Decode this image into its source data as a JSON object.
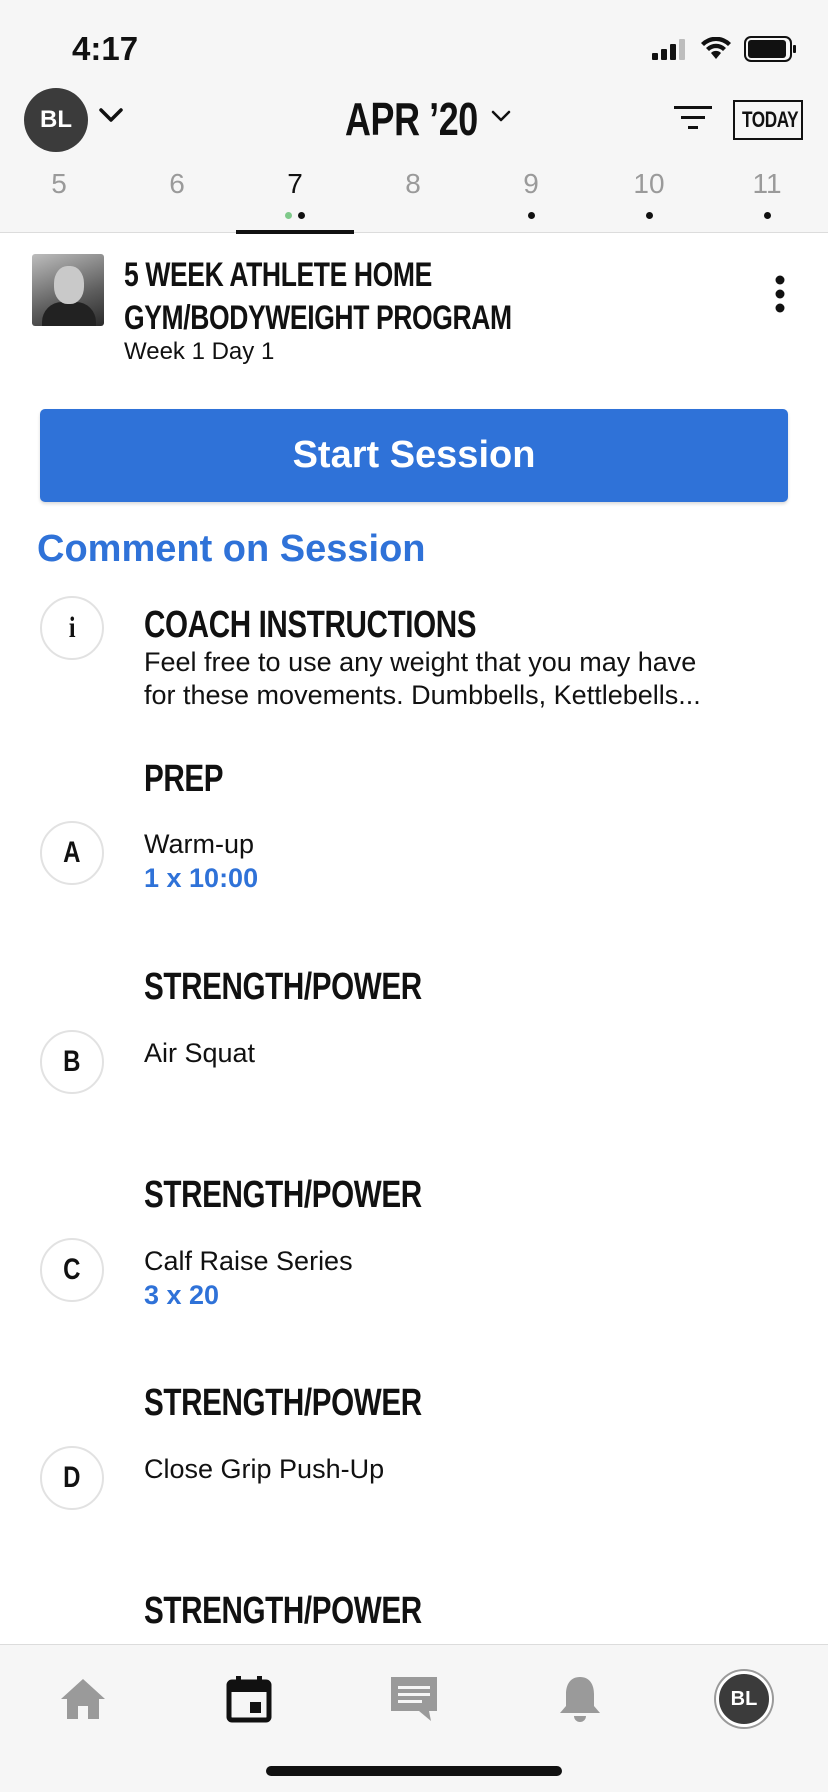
{
  "status": {
    "time": "4:17"
  },
  "header": {
    "avatar_initials": "BL",
    "month": "APR ’20",
    "today_label": "TODAY",
    "days": [
      {
        "num": "5",
        "dots": 0,
        "active": false
      },
      {
        "num": "6",
        "dots": 0,
        "active": false
      },
      {
        "num": "7",
        "dots": 2,
        "active": true
      },
      {
        "num": "8",
        "dots": 0,
        "active": false
      },
      {
        "num": "9",
        "dots": 1,
        "active": false
      },
      {
        "num": "10",
        "dots": 1,
        "active": false
      },
      {
        "num": "11",
        "dots": 1,
        "active": false
      }
    ]
  },
  "program": {
    "title": "5 WEEK ATHLETE HOME GYM/BODYWEIGHT PROGRAM",
    "subtitle": "Week 1 Day 1"
  },
  "actions": {
    "start_session": "Start Session",
    "comment": "Comment on Session"
  },
  "coach_instructions": {
    "badge": "i",
    "title": "COACH INSTRUCTIONS",
    "text_line1": "Feel free to use any weight that you may have",
    "text_line2": "for these movements. Dumbbells, Kettlebells..."
  },
  "sections": [
    {
      "title": "PREP",
      "badge": "A",
      "exercise": "Warm-up",
      "detail": "1 x 10:00"
    },
    {
      "title": "STRENGTH/POWER",
      "badge": "B",
      "exercise": "Air Squat",
      "detail": ""
    },
    {
      "title": "STRENGTH/POWER",
      "badge": "C",
      "exercise": "Calf Raise Series",
      "detail": "3 x 20"
    },
    {
      "title": "STRENGTH/POWER",
      "badge": "D",
      "exercise": "Close Grip Push-Up",
      "detail": ""
    },
    {
      "title": "STRENGTH/POWER",
      "badge": "",
      "exercise": "",
      "detail": ""
    }
  ],
  "tabbar": {
    "tabs": [
      "home-icon",
      "calendar-icon",
      "chat-icon",
      "bell-icon",
      "profile-avatar"
    ],
    "active": "calendar-icon",
    "avatar_initials": "BL"
  },
  "colors": {
    "accent": "#2f72d8",
    "bar_bg": "#f6f6f6",
    "dot_green": "#7fc98a"
  }
}
